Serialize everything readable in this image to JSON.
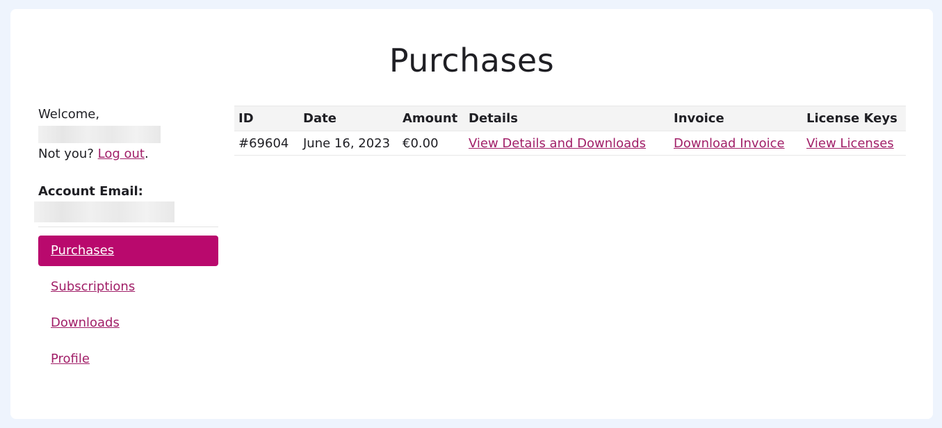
{
  "page": {
    "title": "Purchases"
  },
  "sidebar": {
    "welcome": "Welcome,",
    "not_you_prefix": "Not you? ",
    "logout_label": "Log out",
    "not_you_suffix": ".",
    "account_email_label": "Account Email:",
    "nav": [
      {
        "label": "Purchases",
        "active": true
      },
      {
        "label": "Subscriptions",
        "active": false
      },
      {
        "label": "Downloads",
        "active": false
      },
      {
        "label": "Profile",
        "active": false
      }
    ]
  },
  "table": {
    "headers": [
      "ID",
      "Date",
      "Amount",
      "Details",
      "Invoice",
      "License Keys"
    ],
    "rows": [
      {
        "id": "#69604",
        "date": "June 16, 2023",
        "amount": "€0.00",
        "details": "View Details and Downloads",
        "invoice": "Download Invoice",
        "license": "View Licenses"
      }
    ]
  },
  "colors": {
    "accent": "#b9096d",
    "link": "#a11f68",
    "background": "#eef4fd"
  }
}
